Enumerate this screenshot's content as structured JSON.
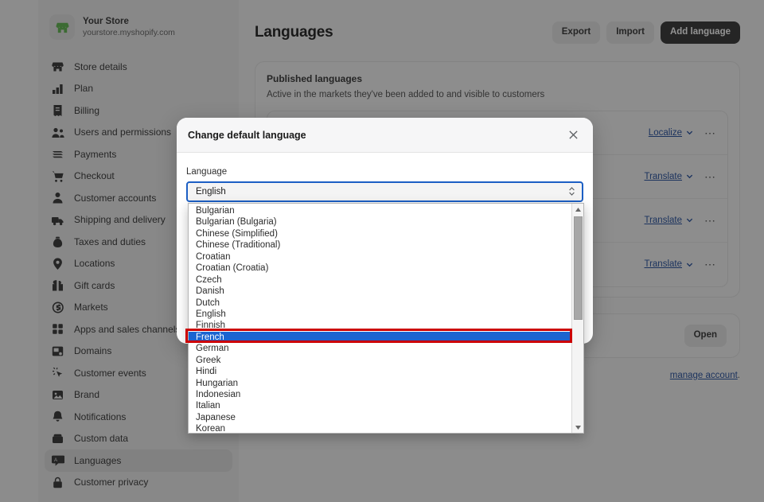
{
  "store": {
    "name": "Your Store",
    "url": "yourstore.myshopify.com",
    "logo_icon": "storefront-icon"
  },
  "sidebar": {
    "items": [
      {
        "label": "Store details",
        "icon": "storefront-icon",
        "active": false
      },
      {
        "label": "Plan",
        "icon": "chart-icon",
        "active": false
      },
      {
        "label": "Billing",
        "icon": "receipt-icon",
        "active": false
      },
      {
        "label": "Users and permissions",
        "icon": "users-icon",
        "active": false
      },
      {
        "label": "Payments",
        "icon": "payments-icon",
        "active": false
      },
      {
        "label": "Checkout",
        "icon": "cart-icon",
        "active": false
      },
      {
        "label": "Customer accounts",
        "icon": "person-icon",
        "active": false
      },
      {
        "label": "Shipping and delivery",
        "icon": "truck-icon",
        "active": false
      },
      {
        "label": "Taxes and duties",
        "icon": "tax-icon",
        "active": false
      },
      {
        "label": "Locations",
        "icon": "pin-icon",
        "active": false
      },
      {
        "label": "Gift cards",
        "icon": "gift-card-icon",
        "active": false
      },
      {
        "label": "Markets",
        "icon": "globe-currency-icon",
        "active": false
      },
      {
        "label": "Apps and sales channels",
        "icon": "apps-grid-icon",
        "active": false
      },
      {
        "label": "Domains",
        "icon": "domain-icon",
        "active": false
      },
      {
        "label": "Customer events",
        "icon": "click-icon",
        "active": false
      },
      {
        "label": "Brand",
        "icon": "image-icon",
        "active": false
      },
      {
        "label": "Notifications",
        "icon": "bell-icon",
        "active": false
      },
      {
        "label": "Custom data",
        "icon": "database-icon",
        "active": false
      },
      {
        "label": "Languages",
        "icon": "translate-icon",
        "active": true
      },
      {
        "label": "Customer privacy",
        "icon": "lock-icon",
        "active": false
      }
    ]
  },
  "header": {
    "title": "Languages",
    "export_label": "Export",
    "import_label": "Import",
    "add_language_label": "Add language"
  },
  "published_card": {
    "title": "Published languages",
    "subtitle": "Active in the markets they've been added to and visible to customers",
    "rows": [
      {
        "action": "Localize",
        "menu_icon": "ellipsis-icon"
      },
      {
        "action": "Translate",
        "menu_icon": "ellipsis-icon"
      },
      {
        "action": "Translate",
        "menu_icon": "ellipsis-icon"
      },
      {
        "action": "Translate",
        "menu_icon": "ellipsis-icon"
      }
    ]
  },
  "secondary_card": {
    "open_label": "Open"
  },
  "footnote": {
    "link_text": "manage account",
    "trailing": "."
  },
  "modal": {
    "title": "Change default language",
    "close_icon": "close-icon",
    "field_label": "Language",
    "select_value": "English",
    "select_arrows_icon": "chevron-updown-icon"
  },
  "dropdown": {
    "selected": "French",
    "scroll_up_icon": "caret-up-icon",
    "scroll_down_icon": "caret-down-icon",
    "options": [
      "Bulgarian",
      "Bulgarian (Bulgaria)",
      "Chinese (Simplified)",
      "Chinese (Traditional)",
      "Croatian",
      "Croatian (Croatia)",
      "Czech",
      "Danish",
      "Dutch",
      "English",
      "Finnish",
      "French",
      "German",
      "Greek",
      "Hindi",
      "Hungarian",
      "Indonesian",
      "Italian",
      "Japanese",
      "Korean"
    ]
  },
  "annotation": {
    "target": "French",
    "color": "#cc0000"
  },
  "colors": {
    "accent_blue": "#1b64d0",
    "link_blue": "#1f4b9c",
    "primary_button": "#303030",
    "sidebar_bg": "#ebebeb",
    "annotation_red": "#cc0000"
  }
}
